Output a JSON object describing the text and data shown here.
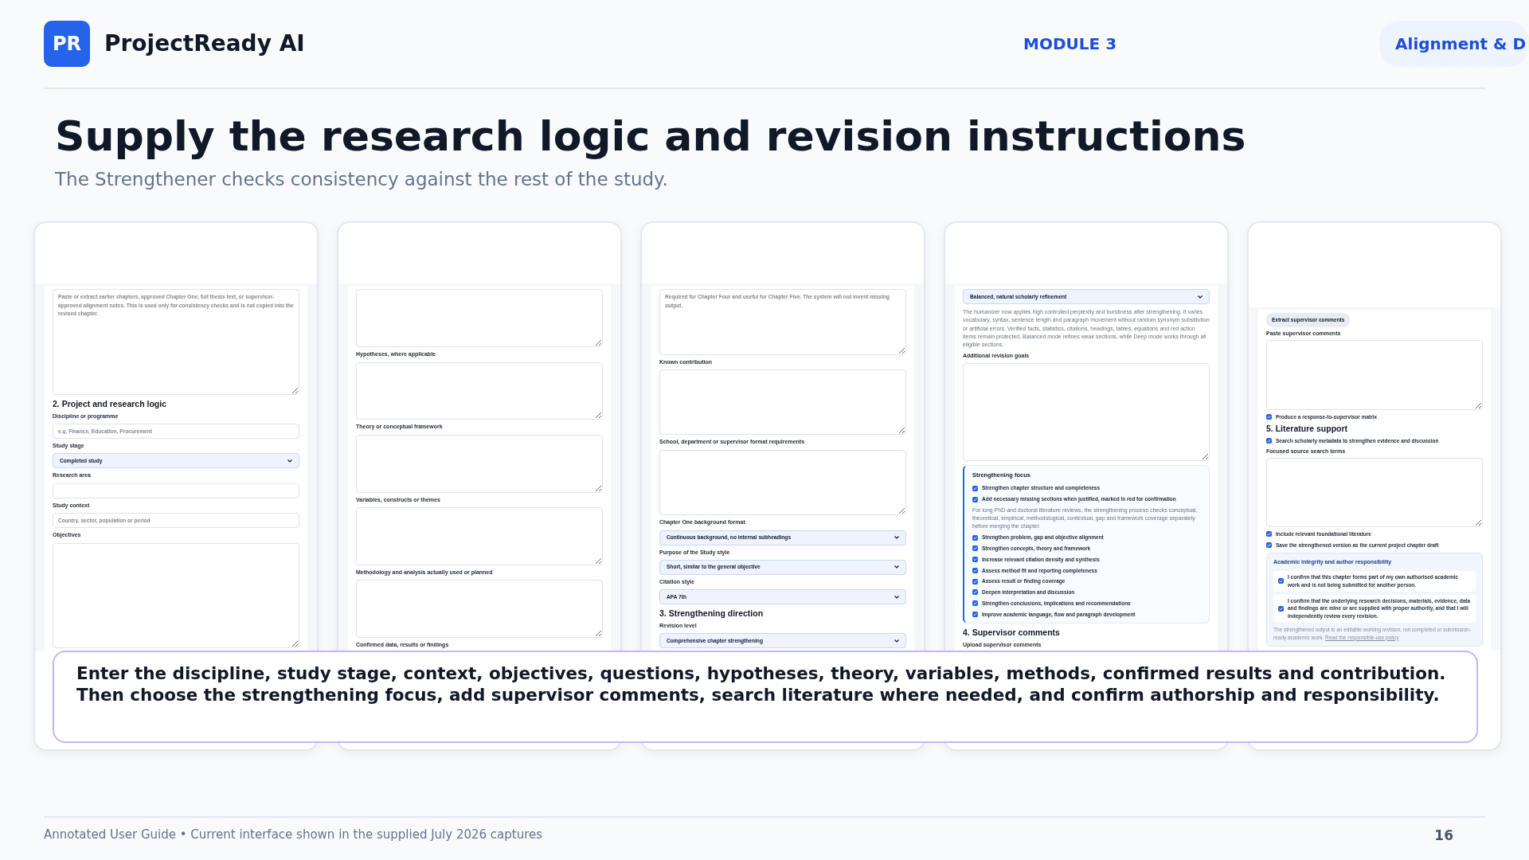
{
  "brand": {
    "logo": "PR",
    "name": "ProjectReady AI"
  },
  "nav": [
    {
      "label": "MODULE 3",
      "selected": false
    },
    {
      "label": "Alignment & D",
      "selected": true
    }
  ],
  "title": "Supply the research logic and revision instructions",
  "subtitle": "The Strengthener checks consistency against the rest of the study.",
  "panels": [
    {
      "items": [
        {
          "kind": "textarea",
          "placeholder": "Paste or extract earlier chapters, approved Chapter One, full thesis text, or supervisor-approved alignment notes. This is used only for consistency checks and is not copied into the revised chapter."
        },
        {
          "kind": "heading",
          "text": "2. Project and research logic"
        },
        {
          "kind": "label",
          "text": "Discipline or programme"
        },
        {
          "kind": "input",
          "placeholder": "e.g. Finance, Education, Procurement"
        },
        {
          "kind": "label",
          "text": "Study stage"
        },
        {
          "kind": "select",
          "value": "Completed study"
        },
        {
          "kind": "label",
          "text": "Research area"
        },
        {
          "kind": "input"
        },
        {
          "kind": "label",
          "text": "Study context"
        },
        {
          "kind": "input",
          "placeholder": "Country, sector, population or period"
        },
        {
          "kind": "label",
          "text": "Objectives"
        },
        {
          "kind": "textarea"
        }
      ]
    },
    {
      "items": [
        {
          "kind": "textarea"
        },
        {
          "kind": "label",
          "text": "Hypotheses, where applicable"
        },
        {
          "kind": "textarea"
        },
        {
          "kind": "label",
          "text": "Theory or conceptual framework"
        },
        {
          "kind": "textarea"
        },
        {
          "kind": "label",
          "text": "Variables, constructs or themes"
        },
        {
          "kind": "textarea"
        },
        {
          "kind": "label",
          "text": "Methodology and analysis actually used or planned"
        },
        {
          "kind": "textarea"
        },
        {
          "kind": "label",
          "text": "Confirmed data, results or findings"
        }
      ]
    },
    {
      "items": [
        {
          "kind": "textarea",
          "placeholder": "Required for Chapter Four and useful for Chapter Five. The system will not invent missing output."
        },
        {
          "kind": "label",
          "text": "Known contribution"
        },
        {
          "kind": "textarea"
        },
        {
          "kind": "label",
          "text": "School, department or supervisor format requirements"
        },
        {
          "kind": "textarea"
        },
        {
          "kind": "label",
          "text": "Chapter One background format"
        },
        {
          "kind": "select",
          "value": "Continuous background, no internal subheadings"
        },
        {
          "kind": "label",
          "text": "Purpose of the Study style"
        },
        {
          "kind": "select",
          "value": "Short, similar to the general objective"
        },
        {
          "kind": "label",
          "text": "Citation style"
        },
        {
          "kind": "select",
          "value": "APA 7th"
        },
        {
          "kind": "heading",
          "text": "3. Strengthening direction"
        },
        {
          "kind": "label",
          "text": "Revision level"
        },
        {
          "kind": "select",
          "value": "Comprehensive chapter strengthening"
        }
      ]
    },
    {
      "items": [
        {
          "kind": "select",
          "value": "Balanced, natural scholarly refinement"
        },
        {
          "kind": "note",
          "text": "The humanizer now applies high controlled perplexity and burstiness after strengthening. It varies vocabulary, syntax, sentence length and paragraph movement without random synonym substitution or artificial errors. Verified facts, statistics, citations, headings, tables, equations and red action items remain protected. Balanced mode refines weak sections, while Deep mode works through all eligible sections."
        },
        {
          "kind": "label",
          "text": "Additional revision goals"
        },
        {
          "kind": "textarea"
        },
        {
          "kind": "focus",
          "title": "Strengthening focus",
          "items": [
            {
              "kind": "checkbox",
              "text": "Strengthen chapter structure and completeness",
              "checked": true
            },
            {
              "kind": "checkbox",
              "text": "Add necessary missing sections when justified, marked in red for confirmation",
              "checked": true
            },
            {
              "kind": "note",
              "text": "For long PhD and doctoral literature reviews, the strengthening process checks conceptual, theoretical, empirical, methodological, contextual, gap and framework coverage separately before merging the chapter."
            },
            {
              "kind": "checkbox",
              "text": "Strengthen problem, gap and objective alignment",
              "checked": true
            },
            {
              "kind": "checkbox",
              "text": "Strengthen concepts, theory and framework",
              "checked": true
            },
            {
              "kind": "checkbox",
              "text": "Increase relevant citation density and synthesis",
              "checked": true
            },
            {
              "kind": "checkbox",
              "text": "Assess method fit and reporting completeness",
              "checked": true
            },
            {
              "kind": "checkbox",
              "text": "Assess result or finding coverage",
              "checked": true
            },
            {
              "kind": "checkbox",
              "text": "Deepen interpretation and discussion",
              "checked": true
            },
            {
              "kind": "checkbox",
              "text": "Strengthen conclusions, implications and recommendations",
              "checked": true
            },
            {
              "kind": "checkbox",
              "text": "Improve academic language, flow and paragraph development",
              "checked": true
            }
          ]
        },
        {
          "kind": "heading",
          "text": "4. Supervisor comments"
        },
        {
          "kind": "label",
          "text": "Upload supervisor comments"
        }
      ]
    },
    {
      "items": [
        {
          "kind": "button",
          "text": "Extract supervisor comments"
        },
        {
          "kind": "label",
          "text": "Paste supervisor comments"
        },
        {
          "kind": "textarea"
        },
        {
          "kind": "checkbox",
          "text": "Produce a response-to-supervisor matrix",
          "checked": true
        },
        {
          "kind": "heading",
          "text": "5. Literature support"
        },
        {
          "kind": "checkbox",
          "text": "Search scholarly metadata to strengthen evidence and discussion",
          "checked": true
        },
        {
          "kind": "label",
          "text": "Focused source search terms"
        },
        {
          "kind": "textarea"
        },
        {
          "kind": "checkbox",
          "text": "Include relevant foundational literature",
          "checked": true
        },
        {
          "kind": "checkbox",
          "text": "Save the strengthened version as the current project chapter draft",
          "checked": true
        },
        {
          "kind": "integrity",
          "title": "Academic integrity and author responsibility",
          "items": [
            {
              "kind": "confirm",
              "text": "I confirm that this chapter forms part of my own authorised academic work and is not being submitted for another person.",
              "checked": true
            },
            {
              "kind": "confirm",
              "text": "I confirm that the underlying research decisions, materials, evidence, data and findings are mine or are supplied with proper authority, and that I will independently review every revision.",
              "checked": true
            },
            {
              "kind": "disclaimer",
              "text": "The strengthened output is an editable working revision, not completed or submission-ready academic work.",
              "link": "Read the responsible-use policy"
            }
          ]
        }
      ]
    }
  ],
  "callout": [
    "Enter the discipline, study stage, context, objectives, questions, hypotheses, theory, variables, methods, confirmed results and contribution.",
    "Then choose the strengthening focus, add supervisor comments, search literature where needed, and confirm authorship and responsibility."
  ],
  "footer": {
    "text": "Annotated User Guide • Current interface shown in the supplied July 2026 captures",
    "page": "16"
  }
}
